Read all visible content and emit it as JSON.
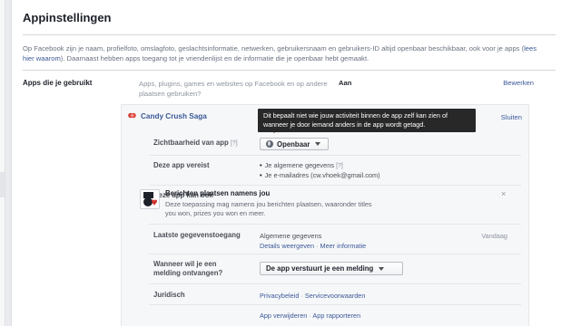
{
  "page": {
    "title": "Appinstellingen",
    "intro_text": "Op Facebook zijn je naam, profielfoto, omslagfoto, geslachtsinformatie, netwerken, gebruikersnaam en gebruikers-ID altijd openbaar beschikbaar, ook voor je apps (",
    "intro_link": "lees hier waarom",
    "intro_text_end": "). Daarnaast hebben apps toegang tot je vriendenlijst en de informatie die je openbaar hebt gemaakt."
  },
  "section": {
    "label": "Apps die je gebruikt",
    "description": "Apps, plugins, games en websites op Facebook en op andere plaatsen gebruiken?",
    "status": "Aan",
    "edit_label": "Bewerken"
  },
  "app": {
    "name": "Candy Crush Saga",
    "close_label": "Sluiten",
    "tooltip": "Dit bepaalt niet wie jouw activiteit binnen de app zelf kan zien of wanneer je door iemand anders in de app wordt getagd.",
    "visibility": {
      "label": "Zichtbaarheid van app",
      "help": "[?]",
      "value": "Openbaar"
    },
    "requires": {
      "label": "Deze app vereist",
      "items": [
        {
          "text": "Je algemene gegevens",
          "help": "[?]"
        },
        {
          "text": "Je e-mailadres (cw.vhoek@gmail.com)"
        }
      ]
    },
    "can_also": {
      "label": "Deze app kan ook",
      "title": "Berichten plaatsen namens jou",
      "description": "Deze toepassing mag namens jou berichten plaatsen, waaronder titles you won, prizes you won en meer.",
      "remove_symbol": "×"
    },
    "last_access": {
      "label": "Laatste gegevenstoegang",
      "value": "Algemene gegevens",
      "date": "Vandaag",
      "details_link": "Details weergeven",
      "separator": " · ",
      "more_link": "Meer informatie"
    },
    "notification": {
      "label_line1": "Wanneer wil je een",
      "label_line2": "melding ontvangen?",
      "value": "De app verstuurt je een melding"
    },
    "legal": {
      "label": "Juridisch",
      "privacy_link": "Privacybeleid",
      "separator": " · ",
      "terms_link": "Servicevoorwaarden"
    },
    "actions": {
      "remove_link": "App verwijderen",
      "separator": " · ",
      "report_link": "App rapporteren"
    }
  },
  "colors": {
    "link": "#3b5998",
    "tooltip_bg": "#282828",
    "card_bg": "#f6f7f9",
    "app_icon_red": "#d0352c"
  }
}
